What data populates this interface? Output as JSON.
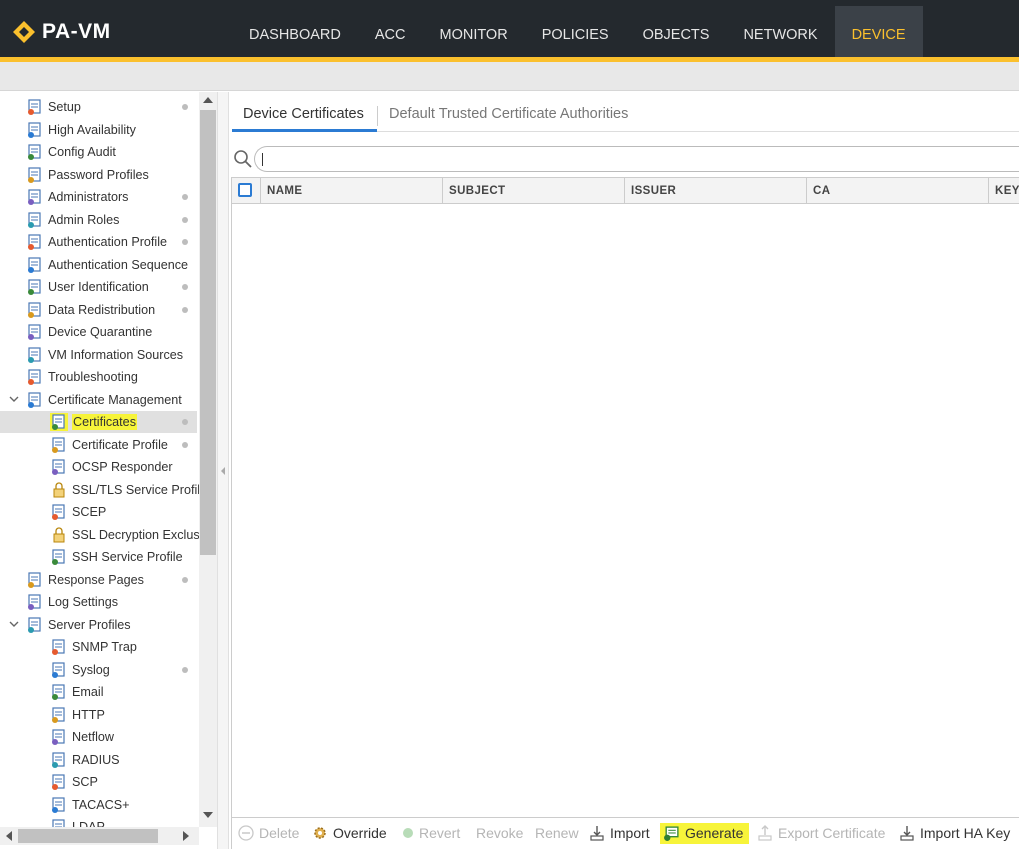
{
  "app": {
    "name": "PA-VM"
  },
  "nav": [
    "DASHBOARD",
    "ACC",
    "MONITOR",
    "POLICIES",
    "OBJECTS",
    "NETWORK",
    "DEVICE"
  ],
  "nav_active": "DEVICE",
  "colors": {
    "header": "#24292e",
    "accent": "#fbc02d",
    "highlight": "#f7f43a",
    "link_blue": "#2b7bd3"
  },
  "sidebar": {
    "items": [
      {
        "label": "Setup",
        "icon": "setup-icon",
        "dot": true
      },
      {
        "label": "High Availability",
        "icon": "high-availability-icon"
      },
      {
        "label": "Config Audit",
        "icon": "config-audit-icon"
      },
      {
        "label": "Password Profiles",
        "icon": "password-profiles-icon"
      },
      {
        "label": "Administrators",
        "icon": "administrators-icon",
        "dot": true
      },
      {
        "label": "Admin Roles",
        "icon": "admin-roles-icon",
        "dot": true
      },
      {
        "label": "Authentication Profile",
        "icon": "authentication-profile-icon",
        "dot": true
      },
      {
        "label": "Authentication Sequence",
        "icon": "authentication-sequence-icon"
      },
      {
        "label": "User Identification",
        "icon": "user-identification-icon",
        "dot": true
      },
      {
        "label": "Data Redistribution",
        "icon": "data-redistribution-icon",
        "dot": true
      },
      {
        "label": "Device Quarantine",
        "icon": "device-quarantine-icon"
      },
      {
        "label": "VM Information Sources",
        "icon": "vm-information-sources-icon"
      },
      {
        "label": "Troubleshooting",
        "icon": "troubleshooting-icon"
      },
      {
        "label": "Certificate Management",
        "icon": "certificate-management-icon",
        "expanded": true
      },
      {
        "label": "Certificates",
        "icon": "certificates-icon",
        "dot": true,
        "child": true,
        "selected": true
      },
      {
        "label": "Certificate Profile",
        "icon": "certificate-profile-icon",
        "dot": true,
        "child": true
      },
      {
        "label": "OCSP Responder",
        "icon": "ocsp-responder-icon",
        "child": true
      },
      {
        "label": "SSL/TLS Service Profile",
        "icon": "lock-icon",
        "child": true
      },
      {
        "label": "SCEP",
        "icon": "scep-icon",
        "child": true
      },
      {
        "label": "SSL Decryption Exclusion",
        "icon": "lock-icon",
        "child": true
      },
      {
        "label": "SSH Service Profile",
        "icon": "ssh-service-profile-icon",
        "child": true
      },
      {
        "label": "Response Pages",
        "icon": "response-pages-icon",
        "dot": true
      },
      {
        "label": "Log Settings",
        "icon": "log-settings-icon"
      },
      {
        "label": "Server Profiles",
        "icon": "server-profiles-icon",
        "expanded": true
      },
      {
        "label": "SNMP Trap",
        "icon": "snmp-trap-icon",
        "child": true
      },
      {
        "label": "Syslog",
        "icon": "syslog-icon",
        "dot": true,
        "child": true
      },
      {
        "label": "Email",
        "icon": "email-icon",
        "child": true
      },
      {
        "label": "HTTP",
        "icon": "http-icon",
        "child": true
      },
      {
        "label": "Netflow",
        "icon": "netflow-icon",
        "child": true
      },
      {
        "label": "RADIUS",
        "icon": "radius-icon",
        "child": true
      },
      {
        "label": "SCP",
        "icon": "scp-icon",
        "child": true
      },
      {
        "label": "TACACS+",
        "icon": "tacacs-icon",
        "child": true
      },
      {
        "label": "LDAP",
        "icon": "ldap-icon",
        "child": true
      }
    ]
  },
  "tabs": [
    "Device Certificates",
    "Default Trusted Certificate Authorities"
  ],
  "search": {
    "value": ""
  },
  "table": {
    "columns": [
      "NAME",
      "SUBJECT",
      "ISSUER",
      "CA",
      "KEY"
    ],
    "rows": []
  },
  "toolbar": {
    "delete": "Delete",
    "override": "Override",
    "revert": "Revert",
    "revoke": "Revoke",
    "renew": "Renew",
    "import": "Import",
    "generate": "Generate",
    "export_certificate": "Export Certificate",
    "import_ha_key": "Import HA Key"
  }
}
